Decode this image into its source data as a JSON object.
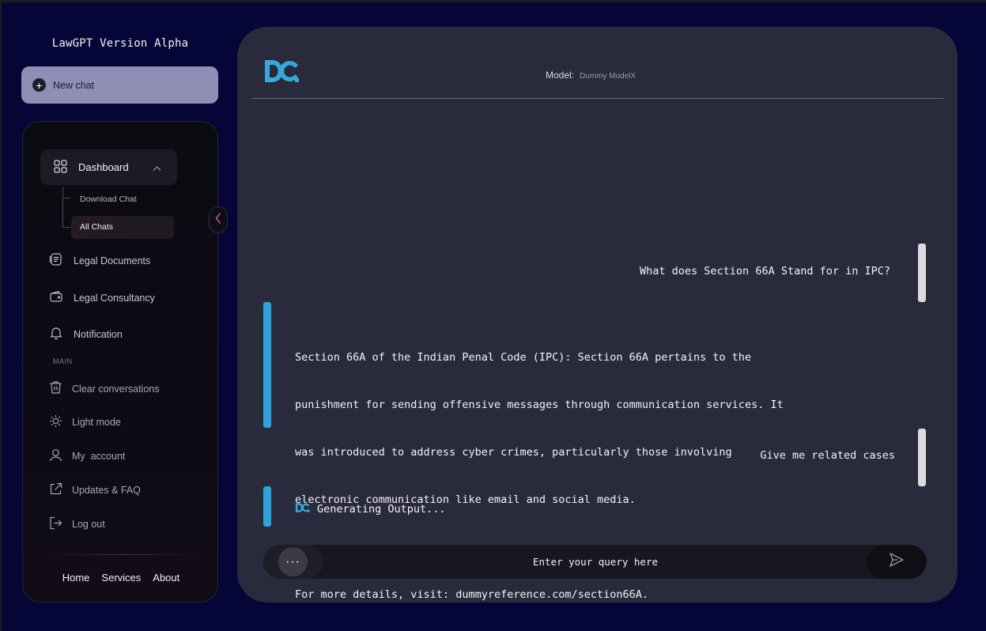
{
  "app": {
    "title": "LawGPT Version Alpha"
  },
  "new_chat": {
    "label": "New chat",
    "icon": "plus-circle-icon"
  },
  "sidebar": {
    "dashboard": {
      "label": "Dashboard",
      "icon": "grid-icon",
      "expanded": true
    },
    "sub_items": [
      {
        "label": "Download Chat"
      },
      {
        "label": "All Chats",
        "active": true
      }
    ],
    "items": [
      {
        "label": "Legal Documents",
        "icon": "documents-icon"
      },
      {
        "label": "Legal Consultancy",
        "icon": "wallet-icon"
      },
      {
        "label": "Notification",
        "icon": "bell-icon"
      }
    ],
    "section_label": "MAIN",
    "main_items": [
      {
        "label": "Clear conversations",
        "icon": "trash-icon"
      },
      {
        "label": "Light mode",
        "icon": "sun-icon"
      },
      {
        "label": "My  account",
        "icon": "user-icon"
      },
      {
        "label": "Updates & FAQ",
        "icon": "external-link-icon"
      },
      {
        "label": "Log out",
        "icon": "logout-icon"
      }
    ],
    "footer": [
      "Home",
      "Services",
      "About"
    ]
  },
  "header": {
    "logo_text": "DC.",
    "model_label": "Model:",
    "model_value": "Dummy ModelX"
  },
  "messages": [
    {
      "role": "user",
      "text": "What does Section 66A Stand for in IPC?"
    },
    {
      "role": "assistant",
      "lines": [
        "Section 66A of the Indian Penal Code (IPC): Section 66A pertains to the",
        "punishment for sending offensive messages through communication services. It",
        "was introduced to address cyber crimes, particularly those involving",
        "electronic communication like email and social media.",
        "",
        "For more details, visit: dummyreference.com/section66A."
      ]
    },
    {
      "role": "user",
      "text": "Give me related cases"
    },
    {
      "role": "assistant",
      "status": "Generating Output..."
    }
  ],
  "composer": {
    "placeholder": "Enter your query here",
    "more_label": "···"
  },
  "colors": {
    "background": "#050537",
    "panel": "#2a2a3d",
    "accent": "#2fa4dc",
    "user_bar": "#dadadf"
  }
}
